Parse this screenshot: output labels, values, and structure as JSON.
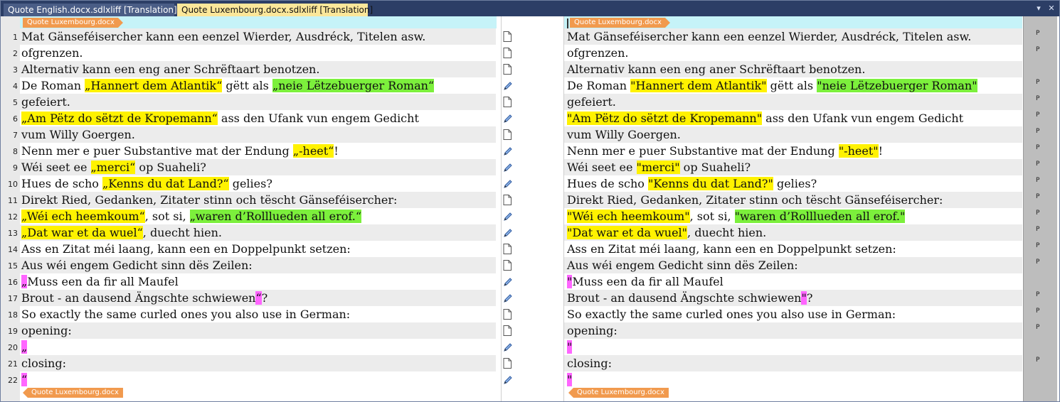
{
  "tabs": [
    {
      "label": "Quote English.docx.sdlxliff [Translation]",
      "active": false
    },
    {
      "label": "Quote Luxembourg.docx.sdlxliff [Translation]",
      "active": true
    }
  ],
  "window_controls": {
    "dropdown": "▾",
    "close": "✕"
  },
  "file_tag": "Quote Luxembourg.docx",
  "rows": [
    {
      "num": "1",
      "status": "page-icon",
      "flag": "P",
      "src": [
        {
          "t": "Mat Gänseféisercher kann een eenzel Wierder, Ausdréck, Titelen asw."
        }
      ],
      "tgt": [
        {
          "t": "Mat Gänseféisercher kann een eenzel Wierder, Ausdréck, Titelen asw."
        }
      ]
    },
    {
      "num": "2",
      "status": "page-icon",
      "flag": "P",
      "src": [
        {
          "t": "ofgrenzen."
        }
      ],
      "tgt": [
        {
          "t": "ofgrenzen."
        }
      ]
    },
    {
      "num": "3",
      "status": "page-icon",
      "flag": "",
      "src": [
        {
          "t": "Alternativ kann een eng aner Schrëftaart benotzen."
        }
      ],
      "tgt": [
        {
          "t": "Alternativ kann een eng aner Schrëftaart benotzen."
        }
      ]
    },
    {
      "num": "4",
      "status": "pencil-icon",
      "flag": "P",
      "src": [
        {
          "t": "De Roman "
        },
        {
          "t": "„Hannert dem Atlantik“",
          "h": "y"
        },
        {
          "t": " gëtt als "
        },
        {
          "t": "„neie Lëtzebuerger Roman“",
          "h": "g"
        }
      ],
      "tgt": [
        {
          "t": "De Roman "
        },
        {
          "t": "\"Hannert dem Atlantik\"",
          "h": "y"
        },
        {
          "t": " gëtt als "
        },
        {
          "t": "\"neie Lëtzebuerger Roman\"",
          "h": "g"
        }
      ]
    },
    {
      "num": "5",
      "status": "page-icon",
      "flag": "P",
      "src": [
        {
          "t": "gefeiert."
        }
      ],
      "tgt": [
        {
          "t": "gefeiert."
        }
      ]
    },
    {
      "num": "6",
      "status": "pencil-icon",
      "flag": "P",
      "src": [
        {
          "t": "„Am Pëtz do sëtzt de Kropemann“",
          "h": "y"
        },
        {
          "t": " ass den Ufank vun engem Gedicht"
        }
      ],
      "tgt": [
        {
          "t": "\"Am Pëtz do sëtzt de Kropemann\"",
          "h": "y"
        },
        {
          "t": " ass den Ufank vun engem Gedicht"
        }
      ]
    },
    {
      "num": "7",
      "status": "page-icon",
      "flag": "P",
      "src": [
        {
          "t": "vum Willy Goergen."
        }
      ],
      "tgt": [
        {
          "t": "vum Willy Goergen."
        }
      ]
    },
    {
      "num": "8",
      "status": "pencil-icon",
      "flag": "P",
      "src": [
        {
          "t": "Nenn mer e puer Substantive mat der Endung "
        },
        {
          "t": "„-heet“",
          "h": "y"
        },
        {
          "t": "!"
        }
      ],
      "tgt": [
        {
          "t": "Nenn mer e puer Substantive mat der Endung "
        },
        {
          "t": "\"-heet\"",
          "h": "y"
        },
        {
          "t": "!"
        }
      ]
    },
    {
      "num": "9",
      "status": "pencil-icon",
      "flag": "P",
      "src": [
        {
          "t": "Wéi seet ee "
        },
        {
          "t": "„merci“",
          "h": "y"
        },
        {
          "t": " op Suaheli?"
        }
      ],
      "tgt": [
        {
          "t": "Wéi seet ee "
        },
        {
          "t": "\"merci\"",
          "h": "y"
        },
        {
          "t": " op Suaheli?"
        }
      ]
    },
    {
      "num": "10",
      "status": "pencil-icon",
      "flag": "P",
      "src": [
        {
          "t": "Hues de scho "
        },
        {
          "t": "„Kenns du dat Land?“",
          "h": "y"
        },
        {
          "t": " gelies?"
        }
      ],
      "tgt": [
        {
          "t": "Hues de scho "
        },
        {
          "t": "\"Kenns du dat Land?\"",
          "h": "y"
        },
        {
          "t": " gelies?"
        }
      ]
    },
    {
      "num": "11",
      "status": "page-icon",
      "flag": "P",
      "src": [
        {
          "t": "Direkt Ried, Gedanken, Zitater stinn och tëscht Gänseféisercher:"
        }
      ],
      "tgt": [
        {
          "t": "Direkt Ried, Gedanken, Zitater stinn och tëscht Gänseféisercher:"
        }
      ]
    },
    {
      "num": "12",
      "status": "pencil-icon",
      "flag": "P",
      "src": [
        {
          "t": "„Wéi ech heemkoum“",
          "h": "y"
        },
        {
          "t": ", sot si, "
        },
        {
          "t": "„waren d’Rolllueden all erof.“",
          "h": "g"
        }
      ],
      "tgt": [
        {
          "t": "\"Wéi ech heemkoum\"",
          "h": "y"
        },
        {
          "t": ", sot si, "
        },
        {
          "t": "\"waren d’Rolllueden all erof.\"",
          "h": "g"
        }
      ]
    },
    {
      "num": "13",
      "status": "pencil-icon",
      "flag": "P",
      "src": [
        {
          "t": "„Dat war et da wuel“",
          "h": "y"
        },
        {
          "t": ", duecht hien."
        }
      ],
      "tgt": [
        {
          "t": "\"Dat war et da wuel\"",
          "h": "y"
        },
        {
          "t": ", duecht hien."
        }
      ]
    },
    {
      "num": "14",
      "status": "page-icon",
      "flag": "P",
      "src": [
        {
          "t": "Ass en Zitat méi laang, kann een en Doppelpunkt setzen:"
        }
      ],
      "tgt": [
        {
          "t": "Ass en Zitat méi laang, kann een en Doppelpunkt setzen:"
        }
      ]
    },
    {
      "num": "15",
      "status": "page-icon",
      "flag": "P",
      "src": [
        {
          "t": "Aus wéi engem Gedicht sinn dës Zeilen:"
        }
      ],
      "tgt": [
        {
          "t": "Aus wéi engem Gedicht sinn dës Zeilen:"
        }
      ]
    },
    {
      "num": "16",
      "status": "pencil-icon",
      "flag": "",
      "src": [
        {
          "t": "„",
          "h": "p"
        },
        {
          "t": "Muss een da fir all Maufel"
        }
      ],
      "tgt": [
        {
          "t": "\"",
          "h": "p"
        },
        {
          "t": "Muss een da fir all Maufel"
        }
      ]
    },
    {
      "num": "17",
      "status": "pencil-icon",
      "flag": "P",
      "src": [
        {
          "t": "Brout - an dausend Ängschte schwiewen"
        },
        {
          "t": "“",
          "h": "p"
        },
        {
          "t": "?"
        }
      ],
      "tgt": [
        {
          "t": "Brout - an dausend Ängschte schwiewen"
        },
        {
          "t": "\"",
          "h": "p"
        },
        {
          "t": "?"
        }
      ]
    },
    {
      "num": "18",
      "status": "page-icon",
      "flag": "P",
      "src": [
        {
          "t": "So exactly the same curled ones you also use in German:"
        }
      ],
      "tgt": [
        {
          "t": "So exactly the same curled ones you also use in German:"
        }
      ]
    },
    {
      "num": "19",
      "status": "page-icon",
      "flag": "P",
      "src": [
        {
          "t": "opening:"
        }
      ],
      "tgt": [
        {
          "t": "opening:"
        }
      ]
    },
    {
      "num": "20",
      "status": "pencil-icon",
      "flag": "",
      "src": [
        {
          "t": "„",
          "h": "p"
        }
      ],
      "tgt": [
        {
          "t": "\"",
          "h": "p"
        }
      ]
    },
    {
      "num": "21",
      "status": "page-icon",
      "flag": "P",
      "src": [
        {
          "t": "closing:"
        }
      ],
      "tgt": [
        {
          "t": "closing:"
        }
      ]
    },
    {
      "num": "22",
      "status": "pencil-icon",
      "flag": "",
      "src": [
        {
          "t": "“",
          "h": "p"
        }
      ],
      "tgt": [
        {
          "t": "\"",
          "h": "p"
        }
      ]
    }
  ]
}
